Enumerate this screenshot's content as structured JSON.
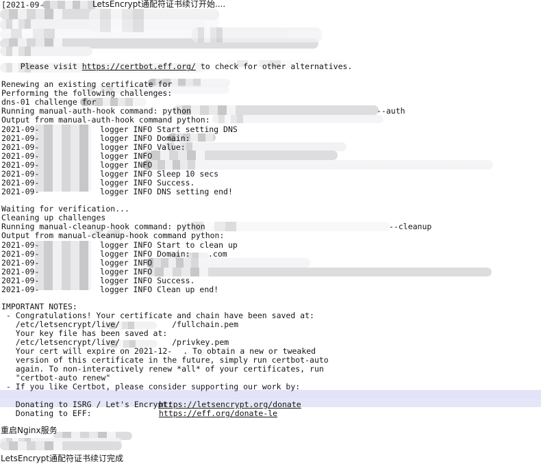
{
  "app": {
    "type": "terminal-log-output",
    "title": "LetsEncrypt通配符证书续订",
    "background_color": "#ffffff",
    "text_color": "#141414",
    "highlight_band_color": "#e2e2f8",
    "link_color": "#141414",
    "redaction_color": "#d6d6d9"
  },
  "lines": {
    "l1_timestamp": "[2021-09-",
    "l1_title": "LetsEncrypt通配符证书续订开始....",
    "l_visit_pre": "Please visit ",
    "l_visit_link": "https://certbot.eff.org/",
    "l_visit_post": " to check for other alternatives.",
    "l_renewing": "Renewing an existing certificate for",
    "l_performing": "Performing the following challenges:",
    "l_dns01": "dns-01 challenge for",
    "l_running_auth": "Running manual-auth-hook command: python",
    "l_output_auth": "Output from manual-auth-hook command python:",
    "l_auth_flag": "--auth",
    "l_waiting": "Waiting for verification...",
    "l_cleaning": "Cleaning up challenges",
    "l_running_cleanup": "Running manual-cleanup-hook command: python",
    "l_output_cleanup": "Output from manual-cleanup-hook command python:",
    "l_cleanup_flag": "--cleanup",
    "l_notes_header": "IMPORTANT NOTES:",
    "l_congrats": " - Congratulations! Your certificate and chain have been saved at:",
    "l_fullchain_pre": "   /etc/letsencrypt/live/",
    "l_fullchain_post": "/fullchain.pem",
    "l_keyfile": "   Your key file has been saved at:",
    "l_privkey_pre": "   /etc/letsencrypt/live/",
    "l_privkey_post": "/privkey.pem",
    "l_expire_pre": "   Your cert will expire on 2021-12-",
    "l_expire_post": ". To obtain a new or tweaked",
    "l_expire2": "   version of this certificate in the future, simply run certbot-auto",
    "l_expire3": "   again. To non-interactively renew *all* of your certificates, run",
    "l_expire4": "   \"certbot-auto renew\"",
    "l_certbot_like": " - If you like Certbot, please consider supporting our work by:",
    "l_donate_isrg_label": "   Donating to ISRG / Let's Encrypt:",
    "l_donate_isrg_link": "https://letsencrypt.org/donate",
    "l_donate_eff_label": "   Donating to EFF:",
    "l_donate_eff_link": "https://eff.org/donate-le",
    "l_restart_nginx": "重启Nginx服务",
    "l_done": "LetsEncrypt通配符证书续订完成"
  },
  "log_entries": {
    "timestamp_prefix": "2021-09-",
    "auth_block": [
      {
        "ts": "2021-09-",
        "logger": "logger INFO ",
        "msg": "Start setting DNS"
      },
      {
        "ts": "2021-09-",
        "logger": "logger INFO ",
        "msg": "Domain:"
      },
      {
        "ts": "2021-09-",
        "logger": "logger INFO ",
        "msg": "Value:"
      },
      {
        "ts": "2021-09-",
        "logger": "logger INFO ",
        "msg": ""
      },
      {
        "ts": "2021-09-",
        "logger": "logger INFO ",
        "msg": ""
      },
      {
        "ts": "2021-09-",
        "logger": "logger INFO ",
        "msg": "Sleep 10 secs"
      },
      {
        "ts": "2021-09-",
        "logger": "logger INFO ",
        "msg": "Success."
      },
      {
        "ts": "2021-09-",
        "logger": "logger INFO ",
        "msg": "DNS setting end!"
      }
    ],
    "cleanup_block": [
      {
        "ts": "2021-09-",
        "logger": "logger INFO ",
        "msg": "Start to clean up"
      },
      {
        "ts": "2021-09-",
        "logger": "logger INFO ",
        "msg": "Domain:",
        "suffix": ".com"
      },
      {
        "ts": "2021-09-",
        "logger": "logger INFO ",
        "msg": ""
      },
      {
        "ts": "2021-09-",
        "logger": "logger INFO ",
        "msg": ""
      },
      {
        "ts": "2021-09-",
        "logger": "logger INFO ",
        "msg": "Success."
      },
      {
        "ts": "2021-09-",
        "logger": "logger INFO ",
        "msg": "Clean up end!"
      }
    ]
  }
}
